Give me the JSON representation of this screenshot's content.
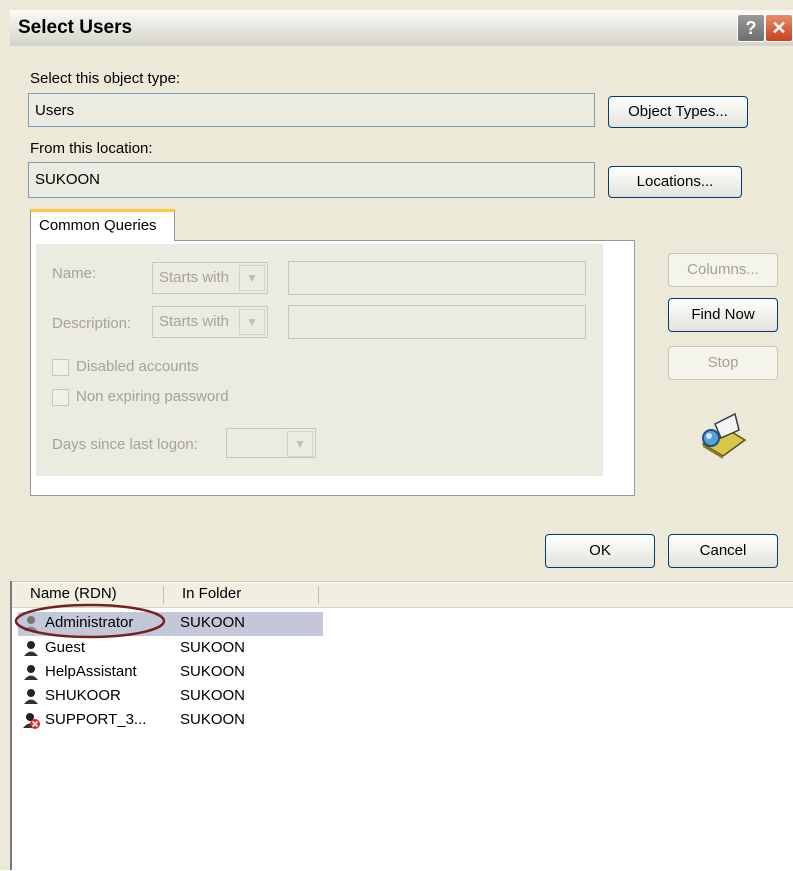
{
  "window": {
    "title": "Select Users",
    "help_glyph": "?",
    "close_glyph": "✕"
  },
  "object_type": {
    "label": "Select this object type:",
    "value": "Users",
    "button": "Object Types..."
  },
  "location": {
    "label": "From this location:",
    "value": "SUKOON",
    "button": "Locations..."
  },
  "tab": {
    "label": "Common Queries"
  },
  "query": {
    "name_label": "Name:",
    "name_match": "Starts with",
    "description_label": "Description:",
    "description_match": "Starts with",
    "disabled_label": "Disabled accounts",
    "nonexpiring_label": "Non expiring password",
    "days_label": "Days since last logon:"
  },
  "side_buttons": {
    "columns": "Columns...",
    "find_now": "Find Now",
    "stop": "Stop"
  },
  "footer": {
    "ok": "OK",
    "cancel": "Cancel"
  },
  "results": {
    "headers": [
      "Name (RDN)",
      "In Folder"
    ],
    "rows": [
      {
        "name": "Administrator",
        "folder": "SUKOON",
        "icon": "user-icon"
      },
      {
        "name": "Guest",
        "folder": "SUKOON",
        "icon": "user-icon"
      },
      {
        "name": "HelpAssistant",
        "folder": "SUKOON",
        "icon": "user-icon"
      },
      {
        "name": "SHUKOOR",
        "folder": "SUKOON",
        "icon": "user-icon"
      },
      {
        "name": "SUPPORT_3...",
        "folder": "SUKOON",
        "icon": "disabled-user-icon"
      }
    ]
  },
  "colors": {
    "accent_border": "#003c74",
    "tab_highlight": "#ffc83c",
    "selection": "#c2c8d8",
    "annotation": "#7a1f1f"
  }
}
